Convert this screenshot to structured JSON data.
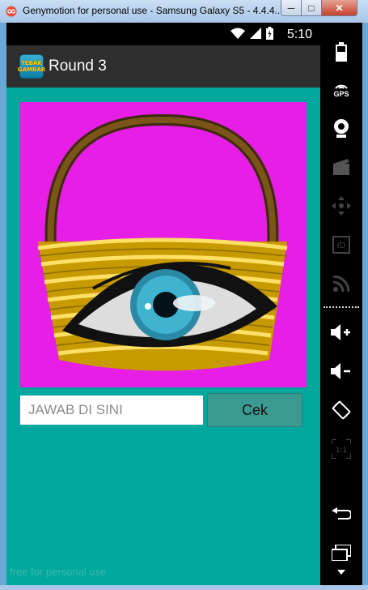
{
  "window": {
    "title": "Genymotion for personal use - Samsung Galaxy S5 - 4.4.4...",
    "minimize": "─",
    "maximize": "□",
    "close": "✕"
  },
  "status_bar": {
    "time": "5:10"
  },
  "action_bar": {
    "app_icon_line1": "TEBAK",
    "app_icon_line2": "GAMBAR",
    "title": "Round 3"
  },
  "game": {
    "answer_placeholder": "JAWAB DI SINI",
    "answer_value": "",
    "check_label": "Cek"
  },
  "watermark": "free for personal use",
  "side_panel": {
    "gps_label": "GPS",
    "icons": [
      "battery-icon",
      "gps-icon",
      "webcam-icon",
      "screencast-icon",
      "move-icon",
      "id-icon",
      "rss-icon",
      "volume-up-icon",
      "volume-down-icon",
      "rotate-icon",
      "pixel-perfect-icon",
      "back-icon",
      "recent-apps-icon",
      "menu-icon"
    ]
  },
  "colors": {
    "content_bg": "#00a79d",
    "picture_bg": "#e61ee6",
    "button_bg": "#3a9a90",
    "action_bar": "#2e2e2e"
  }
}
